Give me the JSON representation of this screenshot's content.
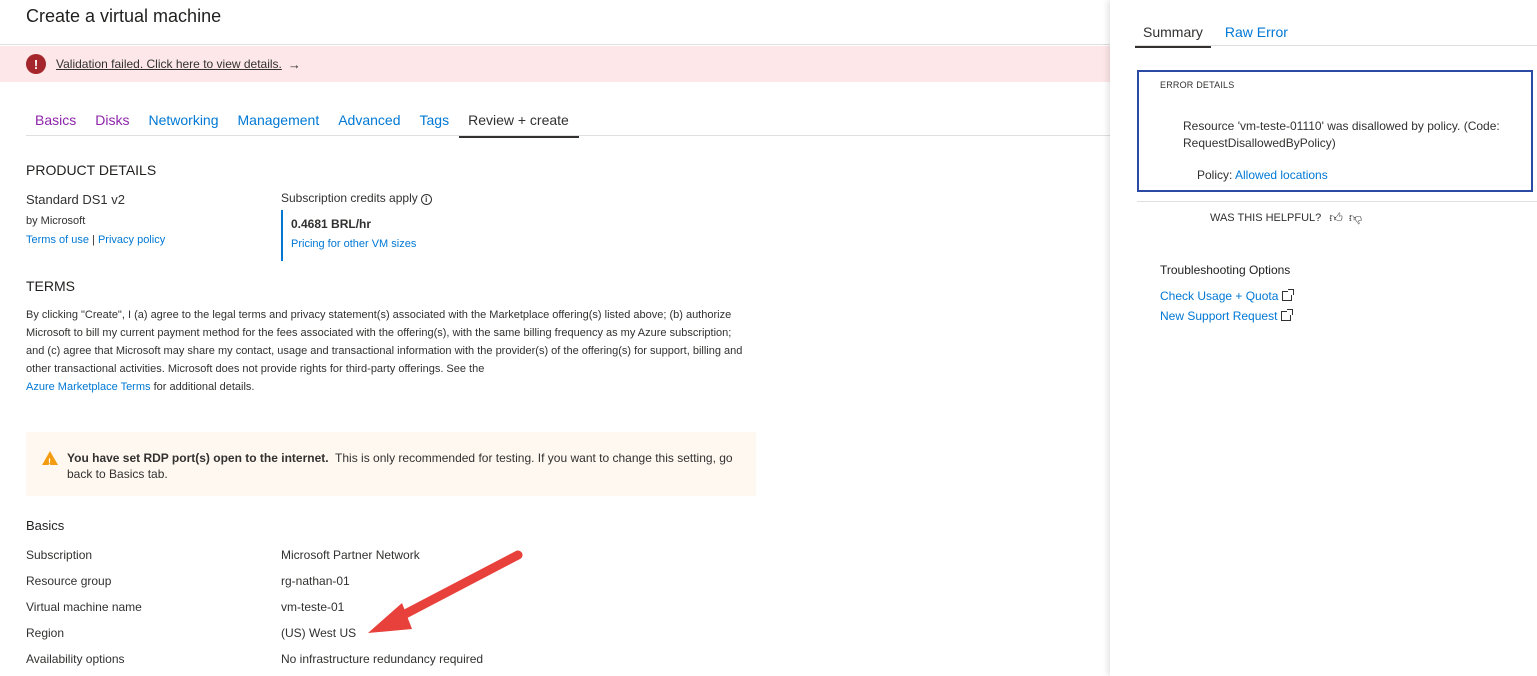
{
  "page": {
    "title": "Create a virtual machine"
  },
  "banner": {
    "text": "Validation failed. Click here to view details.",
    "arrow": "→",
    "icon": "error-icon"
  },
  "tabs": [
    {
      "label": "Basics",
      "state": "visited"
    },
    {
      "label": "Disks",
      "state": "visited"
    },
    {
      "label": "Networking",
      "state": "link"
    },
    {
      "label": "Management",
      "state": "link"
    },
    {
      "label": "Advanced",
      "state": "link"
    },
    {
      "label": "Tags",
      "state": "link"
    },
    {
      "label": "Review + create",
      "state": "active"
    }
  ],
  "product": {
    "heading": "PRODUCT DETAILS",
    "name": "Standard DS1 v2",
    "by": "by Microsoft",
    "terms_link": "Terms of use",
    "separator": "|",
    "privacy_link": "Privacy policy",
    "credits_label": "Subscription credits apply",
    "price": "0.4681 BRL/hr",
    "pricing_link": "Pricing for other VM sizes"
  },
  "terms": {
    "heading": "TERMS",
    "body": "By clicking \"Create\", I (a) agree to the legal terms and privacy statement(s) associated with the Marketplace offering(s) listed above; (b) authorize Microsoft to bill my current payment method for the fees associated with the offering(s), with the same billing frequency as my Azure subscription; and (c) agree that Microsoft may share my contact, usage and transactional information with the provider(s) of the offering(s) for support, billing and other transactional activities. Microsoft does not provide rights for third-party offerings. See the",
    "link": "Azure Marketplace Terms",
    "tail": "for additional details."
  },
  "warning": {
    "bold": "You have set RDP port(s) open to the internet.",
    "text": "This is only recommended for testing.  If you want to change this setting, go back to Basics tab."
  },
  "basics": {
    "heading": "Basics",
    "rows": [
      {
        "label": "Subscription",
        "value": "Microsoft Partner Network"
      },
      {
        "label": "Resource group",
        "value": "rg-nathan-01"
      },
      {
        "label": "Virtual machine name",
        "value": "vm-teste-01"
      },
      {
        "label": "Region",
        "value": "(US) West US"
      },
      {
        "label": "Availability options",
        "value": "No infrastructure redundancy required"
      }
    ]
  },
  "panel": {
    "tabs": [
      "Summary",
      "Raw Error"
    ],
    "error_heading": "ERROR DETAILS",
    "error_message": "Resource 'vm-teste-01110' was disallowed by policy. (Code: RequestDisallowedByPolicy)",
    "policy_label": "Policy:",
    "policy_link": "Allowed locations",
    "helpful": "WAS THIS HELPFUL?",
    "troubleshoot_heading": "Troubleshooting Options",
    "links": [
      "Check Usage + Quota",
      "New Support Request"
    ]
  },
  "colors": {
    "accent": "#0078d4",
    "error": "#a4262c",
    "banner_bg": "#fde7e9",
    "warning": "#f39c12",
    "annotation_arrow": "#e8403a"
  }
}
